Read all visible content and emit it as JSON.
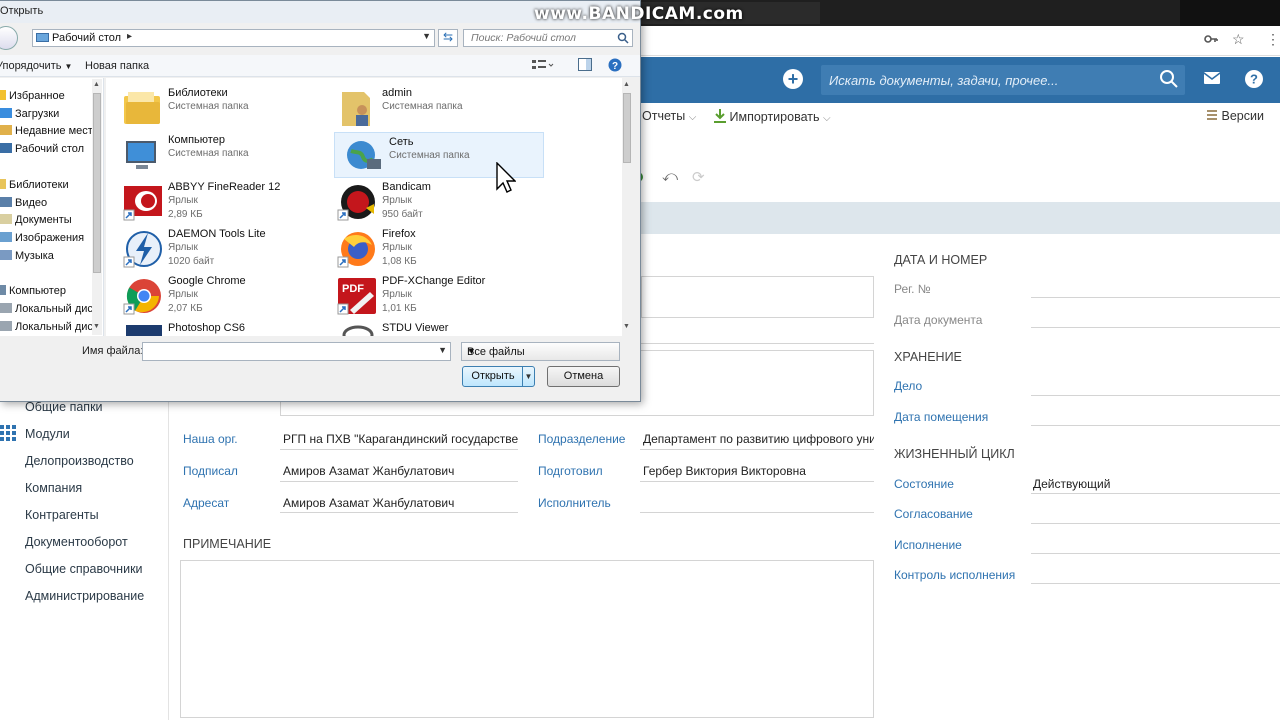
{
  "watermark": "www.BANDICAM.com",
  "app": {
    "search_placeholder": "Искать документы, задачи, прочее...",
    "toolbar": {
      "reports": "Отчеты",
      "import": "Импортировать",
      "versions": "Версии"
    }
  },
  "sidebar": {
    "items": [
      "Общие папки",
      "Модули",
      "Делопроизводство",
      "Компания",
      "Контрагенты",
      "Документооборот",
      "Общие справочники",
      "Администрирование"
    ]
  },
  "form": {
    "fields": {
      "our_org_label": "Наша орг.",
      "our_org_value": "РГП на ПХВ \"Карагандинский государствен",
      "department_label": "Подразделение",
      "department_value": "Департамент по развитию цифрового уни",
      "signed_label": "Подписал",
      "signed_value": "Амиров Азамат Жанбулатович",
      "prepared_label": "Подготовил",
      "prepared_value": "Гербер Виктория Викторовна",
      "addressee_label": "Адресат",
      "addressee_value": "Амиров Азамат Жанбулатович",
      "executor_label": "Исполнитель"
    },
    "note_title": "ПРИМЕЧАНИЕ"
  },
  "right_panel": {
    "date_number_title": "ДАТА И НОМЕР",
    "reg_no_label": "Рег. №",
    "doc_date_label": "Дата документа",
    "storage_title": "ХРАНЕНИЕ",
    "case_label": "Дело",
    "placement_date_label": "Дата помещения",
    "lifecycle_title": "ЖИЗНЕННЫЙ ЦИКЛ",
    "state_label": "Состояние",
    "state_value": "Действующий",
    "approval_label": "Согласование",
    "execution_label": "Исполнение",
    "control_label": "Контроль исполнения"
  },
  "dialog": {
    "title": "Открыть",
    "address": "Рабочий стол",
    "search_placeholder": "Поиск: Рабочий стол",
    "organize": "Упорядочить",
    "new_folder": "Новая папка",
    "nav": {
      "favorites": "Избранное",
      "downloads": "Загрузки",
      "recent": "Недавние места",
      "desktop": "Рабочий стол",
      "libraries": "Библиотеки",
      "video": "Видео",
      "documents": "Документы",
      "images": "Изображения",
      "music": "Музыка",
      "computer": "Компьютер",
      "local_disk_1": "Локальный диск",
      "local_disk_2": "Локальный диск"
    },
    "files": [
      {
        "name": "Библиотеки",
        "type": "Системная папка",
        "size": "",
        "icon": "libraries-icon"
      },
      {
        "name": "admin",
        "type": "Системная папка",
        "size": "",
        "icon": "user-folder-icon"
      },
      {
        "name": "Компьютер",
        "type": "Системная папка",
        "size": "",
        "icon": "computer-icon"
      },
      {
        "name": "Сеть",
        "type": "Системная папка",
        "size": "",
        "icon": "network-icon"
      },
      {
        "name": "ABBYY FineReader 12",
        "type": "Ярлык",
        "size": "2,89 КБ",
        "icon": "abbyy-icon"
      },
      {
        "name": "Bandicam",
        "type": "Ярлык",
        "size": "950 байт",
        "icon": "bandicam-icon"
      },
      {
        "name": "DAEMON Tools Lite",
        "type": "Ярлык",
        "size": "1020 байт",
        "icon": "daemon-tools-icon"
      },
      {
        "name": "Firefox",
        "type": "Ярлык",
        "size": "1,08 КБ",
        "icon": "firefox-icon"
      },
      {
        "name": "Google Chrome",
        "type": "Ярлык",
        "size": "2,07 КБ",
        "icon": "chrome-icon"
      },
      {
        "name": "PDF-XChange Editor",
        "type": "Ярлык",
        "size": "1,01 КБ",
        "icon": "pdf-xchange-icon"
      },
      {
        "name": "Photoshop CS6",
        "type": "",
        "size": "",
        "icon": "photoshop-icon"
      },
      {
        "name": "STDU Viewer",
        "type": "",
        "size": "",
        "icon": "stdu-viewer-icon"
      }
    ],
    "filename_label": "Имя файла:",
    "filename_value": "",
    "filter": "Все файлы",
    "open": "Открыть",
    "cancel": "Отмена"
  }
}
